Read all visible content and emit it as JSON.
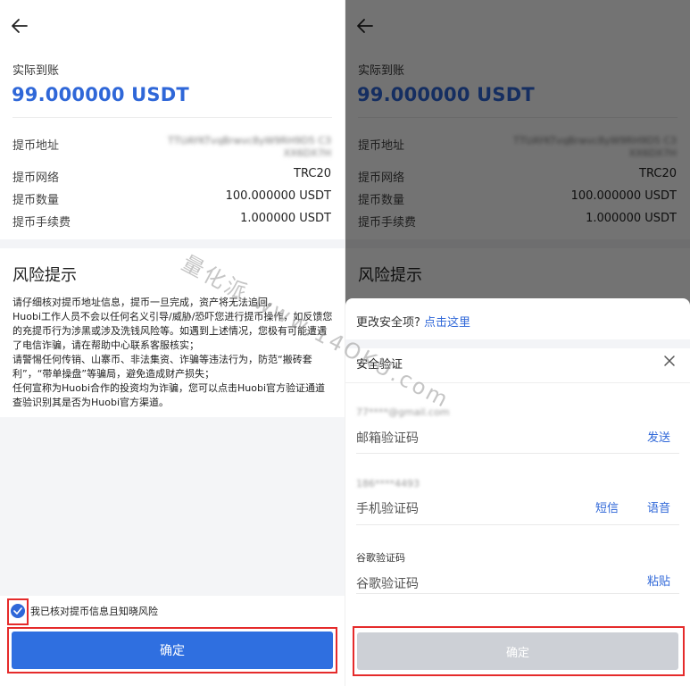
{
  "withdraw": {
    "arrive_label": "实际到账",
    "amount": "99.000000 USDT",
    "address_label": "提币地址",
    "address_value": "TTUAYKTvqBrwvc8yW9RH9D5 C3XX6DX7H",
    "network_label": "提币网络",
    "network_value": "TRC20",
    "quantity_label": "提币数量",
    "quantity_value": "100.000000 USDT",
    "fee_label": "提币手续费",
    "fee_value": "1.000000 USDT"
  },
  "risk": {
    "title": "风险提示",
    "lines": [
      "请仔细核对提币地址信息，提币一旦完成，资产将无法追回。",
      "Huobi工作人员不会以任何名义引导/威胁/恐吓您进行提币操作，如反馈您的充提币行为涉黑或涉及洗钱风险等。如遇到上述情况，您极有可能遭遇了电信诈骗，请在帮助中心联系客服核实；",
      "请警惕任何传销、山寨币、非法集资、诈骗等违法行为，防范“搬砖套利”，“带单操盘”等骗局，避免造成财产损失；",
      "任何宣称为Huobi合作的投资均为诈骗，您可以点击Huobi官方验证通道 查验识别其是否为Huobi官方渠道。"
    ]
  },
  "confirm": {
    "checkbox_label": "我已核对提币信息且知晓风险",
    "button_label": "确定"
  },
  "security": {
    "change_prefix": "更改安全项?",
    "change_link": "点击这里",
    "title": "安全验证",
    "email_account": "77****@gmail.com",
    "email_placeholder": "邮箱验证码",
    "email_send": "发送",
    "phone_account": "186****4493",
    "phone_placeholder": "手机验证码",
    "phone_sms": "短信",
    "phone_voice": "语音",
    "google_label": "谷歌验证码",
    "google_placeholder": "谷歌验证码",
    "google_paste": "粘贴",
    "button_label": "确定"
  },
  "watermark": "量化派 www.14OKU.com",
  "colors": {
    "accent": "#2f67d8",
    "primary_button": "#2f6fe0",
    "disabled_button": "#cdd0d6",
    "highlight_frame": "#e52b2b"
  },
  "icons": {
    "back": "back-arrow-icon",
    "close": "close-icon",
    "check": "checkmark-icon"
  }
}
